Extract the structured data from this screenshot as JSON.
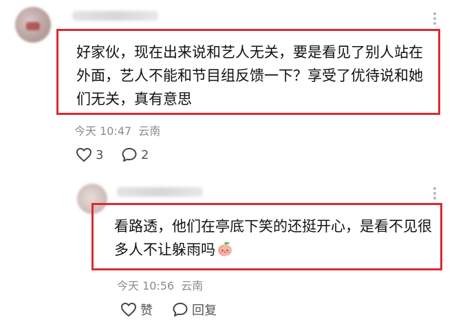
{
  "comment": {
    "text": "好家伙，现在出来说和艺人无关，要是看见了别人站在外面，艺人不能和节目组反馈一下？享受了优待说和她们无关，真有意思",
    "time": "今天 10:47",
    "location": "云南",
    "likes": "3",
    "replies": "2",
    "icons": {
      "like": "heart-icon",
      "comment": "comment-bubble-icon",
      "more": "more-vertical-icon"
    }
  },
  "reply": {
    "text": "看路透，他们在亭底下笑的还挺开心，是看不见很多人不让躲雨吗",
    "emoji": "peach-emoji-icon",
    "time": "今天 10:56",
    "location": "云南",
    "like_label": "赞",
    "reply_label": "回复",
    "icons": {
      "like": "heart-icon",
      "reply": "comment-bubble-icon",
      "more": "more-vertical-icon"
    }
  },
  "colors": {
    "highlight_border": "#e0272f",
    "meta_text": "#8a8a8a",
    "body_text": "#111111"
  }
}
